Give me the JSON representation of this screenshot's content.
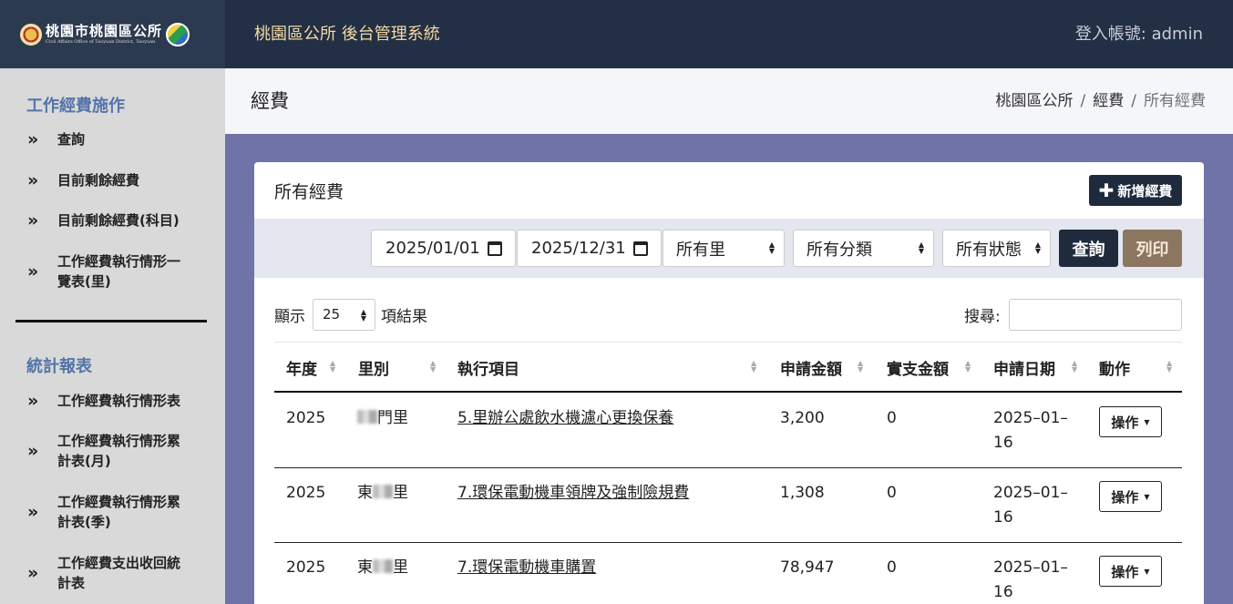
{
  "header": {
    "logo_main": "桃園市桃園區公所",
    "logo_sub": "Civil Affairs Office of Taoyuan District, Taoyuan",
    "app_title": "桃園區公所 後台管理系統",
    "login_info": "登入帳號: admin"
  },
  "sidebar": {
    "sections": [
      {
        "title": "工作經費施作",
        "items": [
          "查詢",
          "目前剩餘經費",
          "目前剩餘經費(科目)",
          "工作經費執行情形一覽表(里)"
        ]
      },
      {
        "title": "統計報表",
        "items": [
          "工作經費執行情形表",
          "工作經費執行情形累計表(月)",
          "工作經費執行情形累計表(季)",
          "工作經費支出收回統計表"
        ]
      }
    ],
    "nav_glyph": "»"
  },
  "content": {
    "page_title": "經費",
    "breadcrumb": [
      "桃園區公所",
      "經費",
      "所有經費"
    ]
  },
  "card": {
    "title": "所有經費",
    "add_button": "新增經費",
    "filters": {
      "date_from": "2025/01/01",
      "date_to": "2025/12/31",
      "village": "所有里",
      "category": "所有分類",
      "status": "所有狀態",
      "query_button": "查詢",
      "print_button": "列印"
    },
    "length": {
      "prefix": "顯示",
      "value": "25",
      "suffix": "項結果"
    },
    "search_label": "搜尋:",
    "columns": [
      "年度",
      "里別",
      "執行項目",
      "申請金額",
      "實支金額",
      "申請日期",
      "動作"
    ],
    "rows": [
      {
        "year": "2025",
        "village_pre": "",
        "village_post": "門里",
        "item": "5.里辦公處飲水機濾心更換保養",
        "amount": "3,200",
        "actual": "0",
        "date": "2025–01–16",
        "action": "操作"
      },
      {
        "year": "2025",
        "village_pre": "東",
        "village_post": "里",
        "item": "7.環保電動機車領牌及強制險規費",
        "amount": "1,308",
        "actual": "0",
        "date": "2025–01–16",
        "action": "操作"
      },
      {
        "year": "2025",
        "village_pre": "東",
        "village_post": "里",
        "item": "7.環保電動機車購置",
        "amount": "78,947",
        "actual": "0",
        "date": "2025–01–16",
        "action": "操作"
      }
    ]
  },
  "colors": {
    "topbar": "#222f44",
    "logo_bg": "#2b3a4f",
    "app_title": "#f3d9a4",
    "sidebar_bg": "#d9d9d9",
    "section_title": "#5375a9",
    "content_bg": "#6f73a8",
    "primary_button": "#1f2b3d",
    "print_button": "#8b7660"
  },
  "icons": {
    "nav": "double-chevron-right-icon",
    "add": "plus-icon",
    "calendar": "calendar-icon",
    "sort": "sort-arrows-icon",
    "select": "select-arrows-icon",
    "dropdown": "caret-down-icon"
  }
}
